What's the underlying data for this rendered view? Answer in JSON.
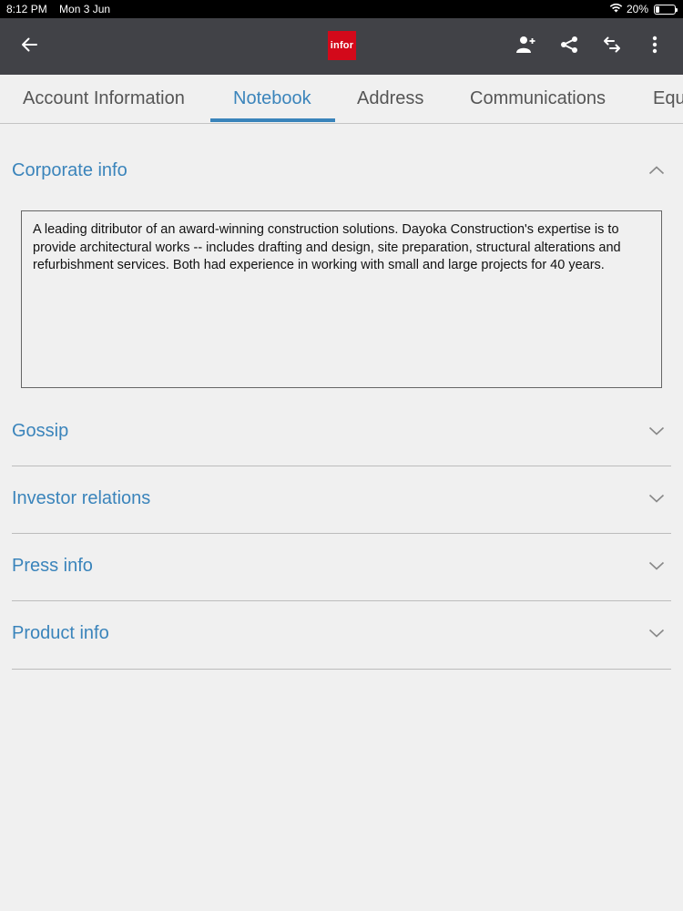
{
  "status_bar": {
    "time": "8:12 PM",
    "date": "Mon 3 Jun",
    "battery_percent_label": "20%",
    "battery_level": 0.2
  },
  "app_bar": {
    "logo_text": "infor",
    "logo_color": "#d3091a",
    "icons": [
      "back-arrow-icon",
      "add-contact-icon",
      "share-icon",
      "swap-icon",
      "more-vertical-icon"
    ]
  },
  "tabs": [
    {
      "label": "Account Information",
      "active": false
    },
    {
      "label": "Notebook",
      "active": true
    },
    {
      "label": "Address",
      "active": false
    },
    {
      "label": "Communications",
      "active": false
    },
    {
      "label": "Equ",
      "active": false
    }
  ],
  "accent_color": "#3a84bb",
  "sections": [
    {
      "title": "Corporate info",
      "expanded": true,
      "content": "A leading ditributor of an award-winning construction solutions. Dayoka Construction's expertise is to provide architectural works -- includes drafting and design, site preparation, structural alterations and refurbishment services. Both had experience in working with small and large projects for 40 years."
    },
    {
      "title": "Gossip",
      "expanded": false
    },
    {
      "title": "Investor relations",
      "expanded": false
    },
    {
      "title": "Press info",
      "expanded": false
    },
    {
      "title": "Product info",
      "expanded": false
    }
  ]
}
